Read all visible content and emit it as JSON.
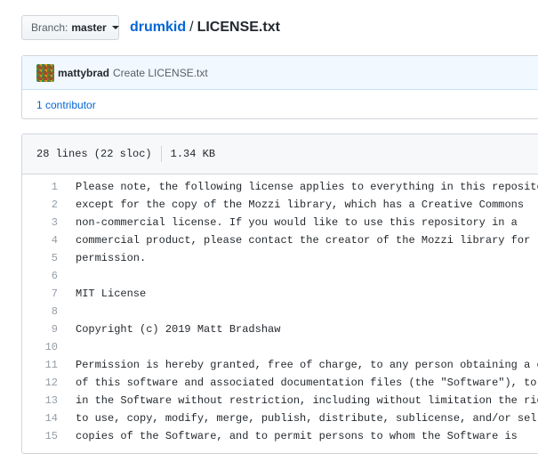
{
  "branch": {
    "label": "Branch:",
    "value": "master"
  },
  "breadcrumb": {
    "repo": "drumkid",
    "separator": "/",
    "file": "LICENSE.txt"
  },
  "commit": {
    "author": "mattybrad",
    "message": "Create LICENSE.txt",
    "contributors": "1 contributor"
  },
  "file": {
    "lines_info": "28 lines (22 sloc)",
    "size": "1.34 KB",
    "lines": [
      {
        "num": "1",
        "text": "Please note, the following license applies to everything in this repository"
      },
      {
        "num": "2",
        "text": "except for the copy of the Mozzi library, which has a Creative Commons"
      },
      {
        "num": "3",
        "text": "non-commercial license. If you would like to use this repository in a"
      },
      {
        "num": "4",
        "text": "commercial product, please contact the creator of the Mozzi library for"
      },
      {
        "num": "5",
        "text": "permission."
      },
      {
        "num": "6",
        "text": ""
      },
      {
        "num": "7",
        "text": "MIT License"
      },
      {
        "num": "8",
        "text": ""
      },
      {
        "num": "9",
        "text": "Copyright (c) 2019 Matt Bradshaw"
      },
      {
        "num": "10",
        "text": ""
      },
      {
        "num": "11",
        "text": "Permission is hereby granted, free of charge, to any person obtaining a copy"
      },
      {
        "num": "12",
        "text": "of this software and associated documentation files (the \"Software\"), to deal"
      },
      {
        "num": "13",
        "text": "in the Software without restriction, including without limitation the rights"
      },
      {
        "num": "14",
        "text": "to use, copy, modify, merge, publish, distribute, sublicense, and/or sell"
      },
      {
        "num": "15",
        "text": "copies of the Software, and to permit persons to whom the Software is"
      }
    ]
  }
}
